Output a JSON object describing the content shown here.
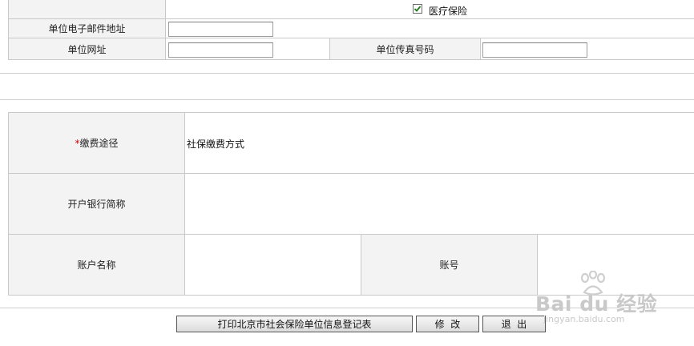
{
  "insurance": {
    "medical_label": "医疗保险",
    "medical_checked": true
  },
  "unit_info": {
    "email_label": "单位电子邮件地址",
    "email_value": "",
    "website_label": "单位网址",
    "website_value": "",
    "fax_label": "单位传真号码",
    "fax_value": ""
  },
  "payment": {
    "required_mark": "*",
    "method_label": "缴费途径",
    "method_value": "社保缴费方式",
    "bank_label": "开户银行简称",
    "bank_value": "",
    "account_name_label": "账户名称",
    "account_name_value": "",
    "account_no_label": "账号",
    "account_no_value": ""
  },
  "actions": {
    "print_label": "打印北京市社会保险单位信息登记表",
    "modify_label": "修  改",
    "exit_label": "退  出"
  },
  "watermark": {
    "brand": "Bai du 经验",
    "url": "jingyan.baidu.com"
  }
}
